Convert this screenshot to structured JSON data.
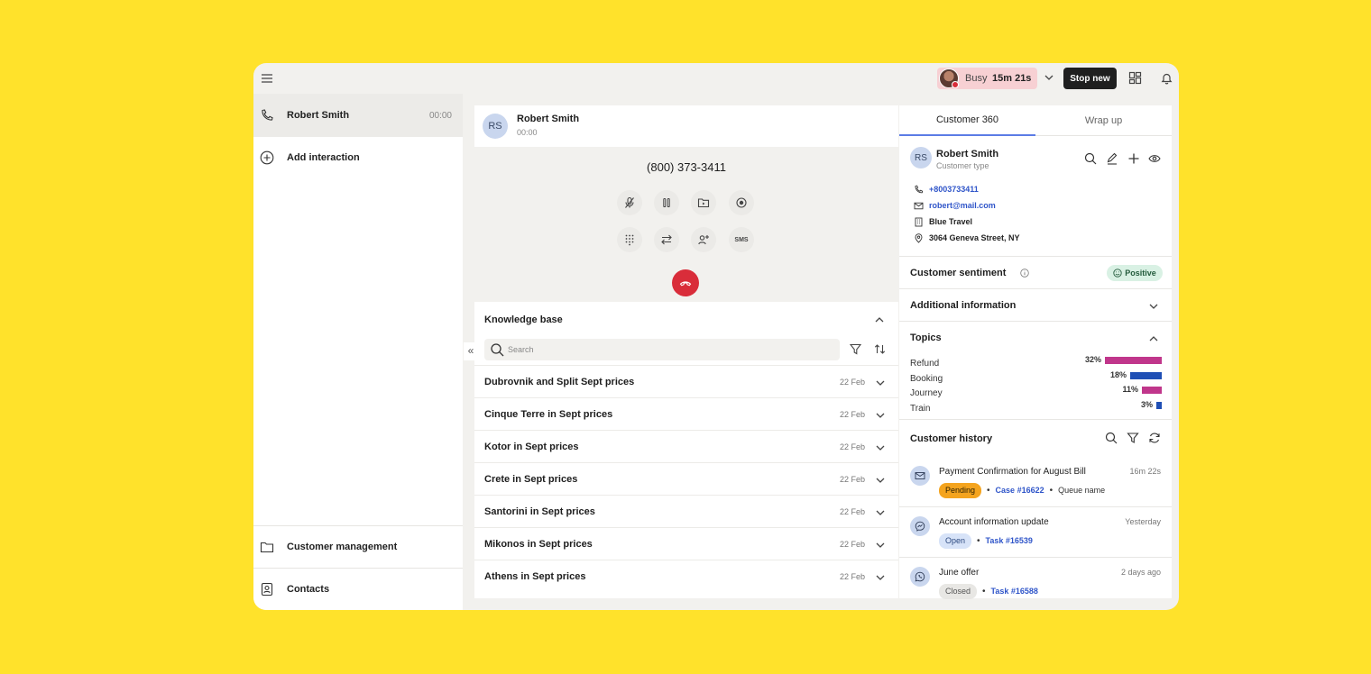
{
  "topbar": {
    "status_label": "Busy",
    "status_timer": "15m 21s",
    "stop_label": "Stop new"
  },
  "sidebar": {
    "items": [
      {
        "label": "Robert Smith",
        "time": "00:00"
      },
      {
        "label": "Add interaction"
      },
      {
        "label": "Customer management"
      },
      {
        "label": "Contacts"
      }
    ],
    "collapse_glyph": "«"
  },
  "call": {
    "initials": "RS",
    "name": "Robert Smith",
    "duration": "00:00",
    "phone": "(800) 373-3411",
    "sms_label": "SMS"
  },
  "knowledge_base": {
    "title": "Knowledge base",
    "search_placeholder": "Search",
    "articles": [
      {
        "title": "Dubrovnik and Split Sept prices",
        "date": "22 Feb"
      },
      {
        "title": "Cinque Terre in Sept prices",
        "date": "22 Feb"
      },
      {
        "title": "Kotor in Sept prices",
        "date": "22 Feb"
      },
      {
        "title": "Crete in Sept prices",
        "date": "22 Feb"
      },
      {
        "title": "Santorini in Sept prices",
        "date": "22 Feb"
      },
      {
        "title": "Mikonos in Sept prices",
        "date": "22 Feb"
      },
      {
        "title": "Athens in Sept prices",
        "date": "22 Feb"
      }
    ]
  },
  "customer": {
    "tabs": [
      "Customer 360",
      "Wrap up"
    ],
    "initials": "RS",
    "name": "Robert Smith",
    "type": "Customer type",
    "phone": "+8003733411",
    "email": "robert@mail.com",
    "company": "Blue Travel",
    "address": "3064 Geneva Street, NY",
    "sentiment_label": "Customer sentiment",
    "sentiment_value": "Positive",
    "additional_label": "Additional information",
    "topics_label": "Topics",
    "topics": [
      {
        "name": "Refund",
        "pct": "32%",
        "value": 32,
        "color": "#C0368B"
      },
      {
        "name": "Booking",
        "pct": "18%",
        "value": 18,
        "color": "#1F4FB5"
      },
      {
        "name": "Journey",
        "pct": "11%",
        "value": 11,
        "color": "#C0368B"
      },
      {
        "name": "Train",
        "pct": "3%",
        "value": 3,
        "color": "#1F4FB5"
      }
    ],
    "history_label": "Customer history",
    "history": [
      {
        "title": "Payment Confirmation for August Bill",
        "time": "16m 22s",
        "status": "Pending",
        "ref": "Case #16622",
        "queue": "Queue name",
        "icon": "mail-icon"
      },
      {
        "title": "Account information update",
        "time": "Yesterday",
        "status": "Open",
        "ref": "Task #16539",
        "icon": "messenger-icon"
      },
      {
        "title": "June offer",
        "time": "2 days ago",
        "status": "Closed",
        "ref": "Task #16588",
        "icon": "whatsapp-icon"
      }
    ]
  },
  "colors": {
    "background": "#FFE22B",
    "busy_pill": "#F7D0D3",
    "hangup": "#D92D3A",
    "accent_tab": "#5c7ce5",
    "link": "#2F55C9"
  }
}
